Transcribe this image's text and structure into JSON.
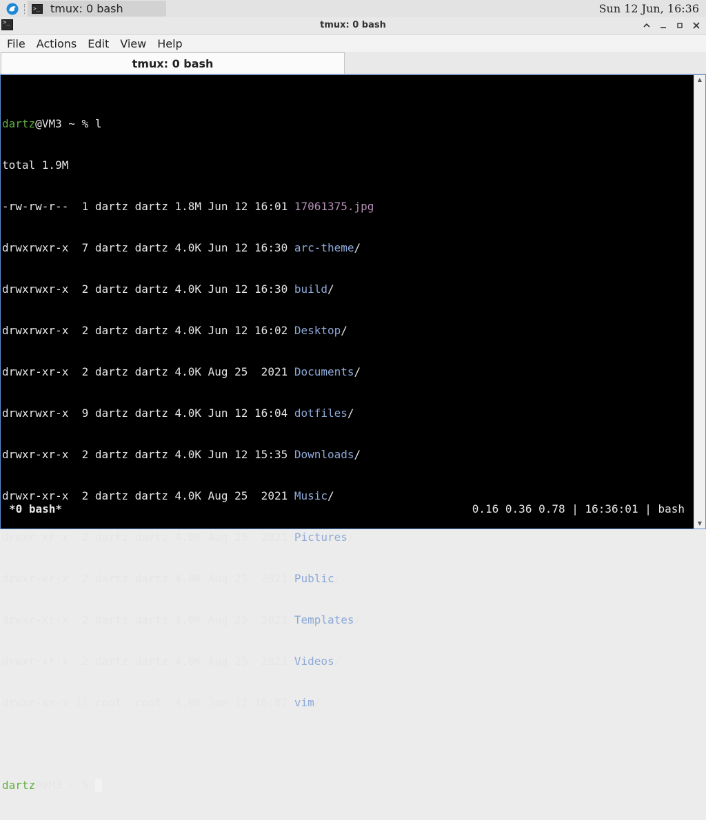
{
  "panel": {
    "task_title": "tmux: 0 bash",
    "clock": "Sun 12 Jun, 16:36"
  },
  "window": {
    "title": "tmux: 0 bash",
    "icon_label": ">_"
  },
  "menu": [
    "File",
    "Actions",
    "Edit",
    "View",
    "Help"
  ],
  "tab": {
    "label": "tmux: 0 bash"
  },
  "terminal": {
    "prompt": {
      "user": "dartz",
      "host": "@VM3 ~ % "
    },
    "command": "l",
    "total": "total 1.9M",
    "entries": [
      {
        "meta": "-rw-rw-r--  1 dartz dartz 1.8M Jun 12 16:01 ",
        "name": "17061375.jpg",
        "suffix": ""
      },
      {
        "meta": "drwxrwxr-x  7 dartz dartz 4.0K Jun 12 16:30 ",
        "name": "arc-theme",
        "suffix": "/"
      },
      {
        "meta": "drwxrwxr-x  2 dartz dartz 4.0K Jun 12 16:30 ",
        "name": "build",
        "suffix": "/"
      },
      {
        "meta": "drwxrwxr-x  2 dartz dartz 4.0K Jun 12 16:02 ",
        "name": "Desktop",
        "suffix": "/"
      },
      {
        "meta": "drwxr-xr-x  2 dartz dartz 4.0K Aug 25  2021 ",
        "name": "Documents",
        "suffix": "/"
      },
      {
        "meta": "drwxrwxr-x  9 dartz dartz 4.0K Jun 12 16:04 ",
        "name": "dotfiles",
        "suffix": "/"
      },
      {
        "meta": "drwxr-xr-x  2 dartz dartz 4.0K Jun 12 15:35 ",
        "name": "Downloads",
        "suffix": "/"
      },
      {
        "meta": "drwxr-xr-x  2 dartz dartz 4.0K Aug 25  2021 ",
        "name": "Music",
        "suffix": "/"
      },
      {
        "meta": "drwxr-xr-x  2 dartz dartz 4.0K Aug 25  2021 ",
        "name": "Pictures",
        "suffix": "/"
      },
      {
        "meta": "drwxr-xr-x  2 dartz dartz 4.0K Aug 25  2021 ",
        "name": "Public",
        "suffix": "/"
      },
      {
        "meta": "drwxr-xr-x  2 dartz dartz 4.0K Aug 25  2021 ",
        "name": "Templates",
        "suffix": "/"
      },
      {
        "meta": "drwxr-xr-x  2 dartz dartz 4.0K Aug 25  2021 ",
        "name": "Videos",
        "suffix": "/"
      },
      {
        "meta": "drwxr-xr-x 11 root  root  4.0K Jun 12 16:07 ",
        "name": "vim",
        "suffix": "/"
      }
    ]
  },
  "status_bar": {
    "window": "*0 bash*",
    "info": "0.16 0.36 0.78 | 16:36:01 | bash"
  },
  "colors": {
    "prompt_user": "#5faf3c",
    "directory": "#8ea9d8",
    "image_file": "#b58fb6"
  }
}
